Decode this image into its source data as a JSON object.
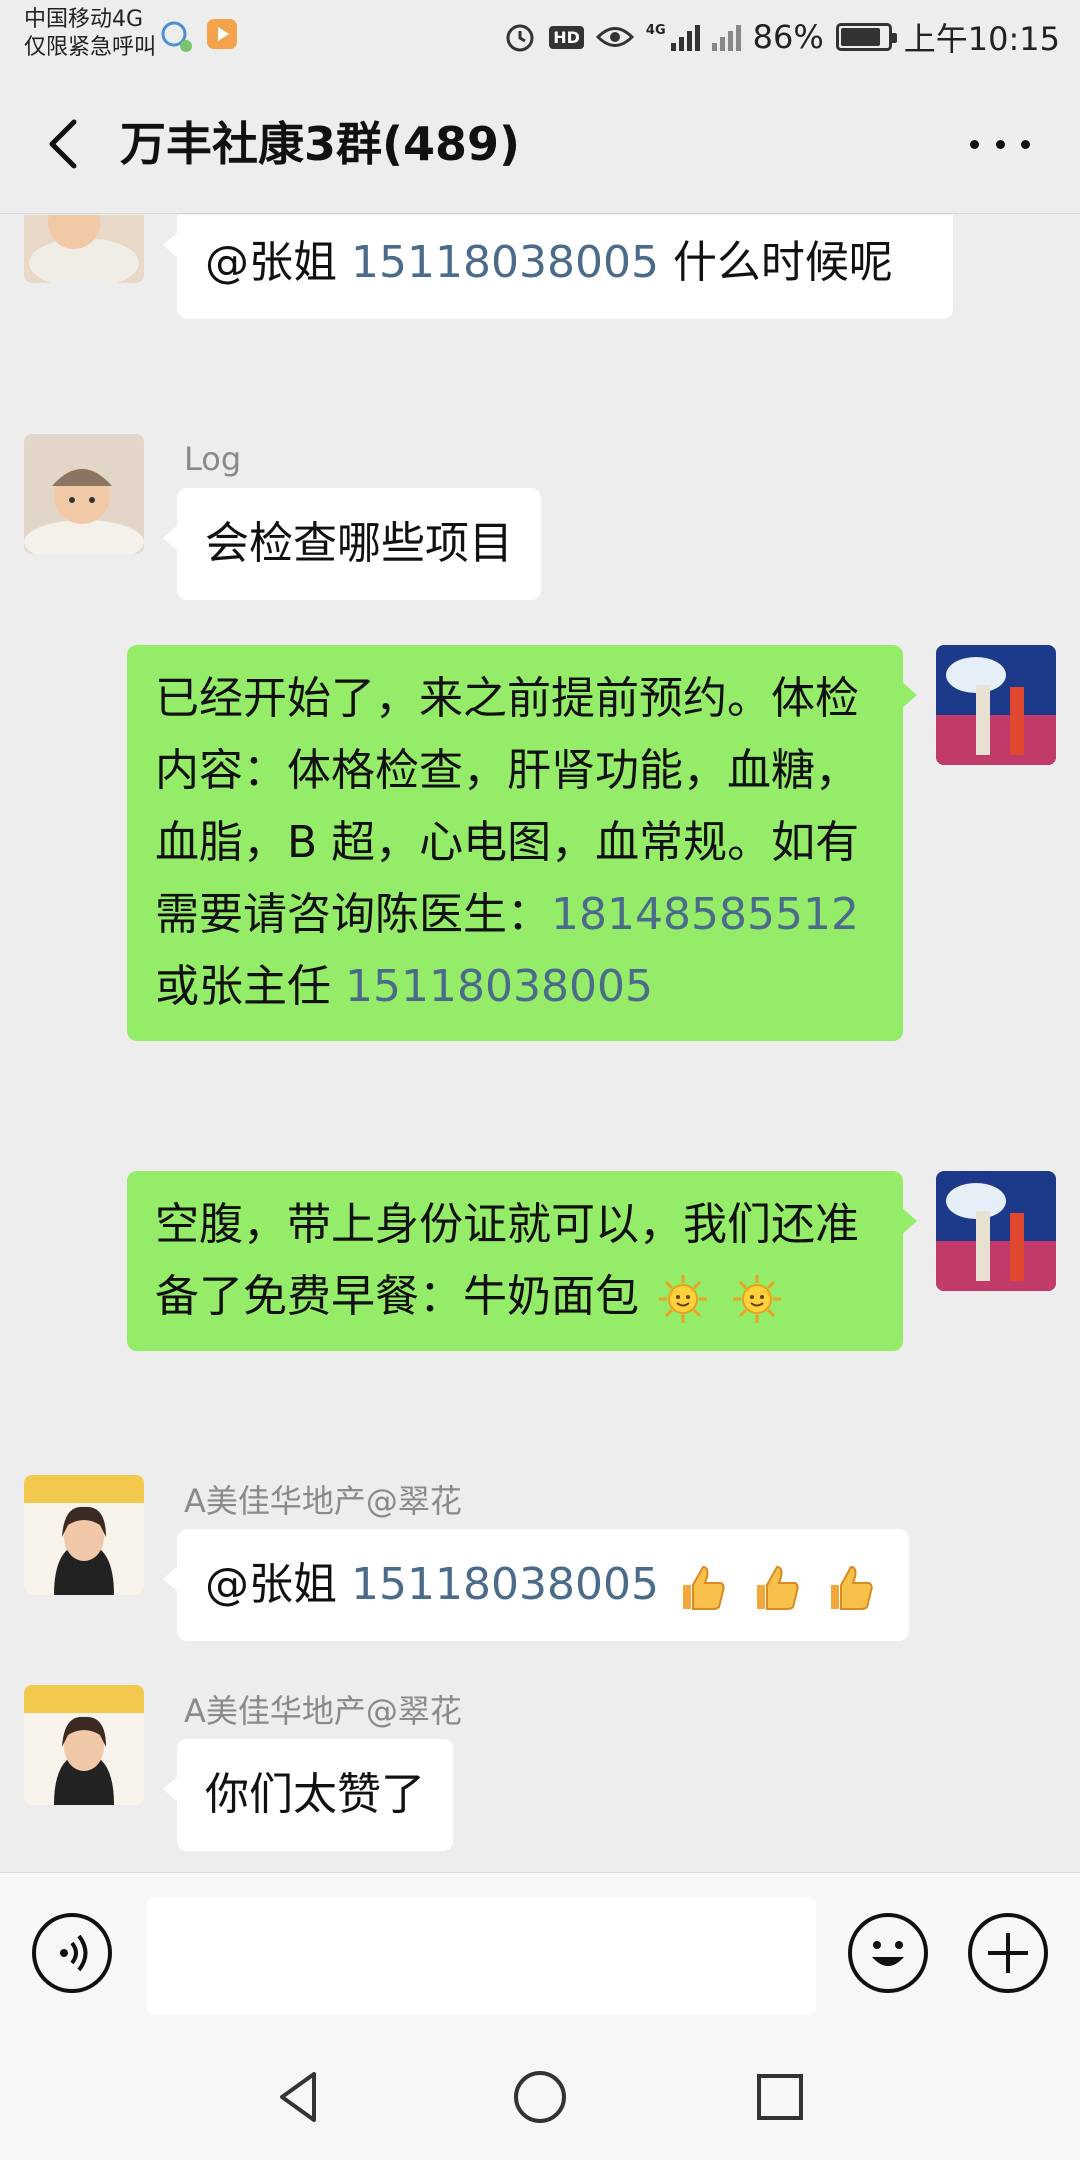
{
  "status_bar": {
    "carrier_line1": "中国移动4G",
    "carrier_line2": "仅限紧急呼叫",
    "hd_badge": "HD",
    "net_label": "4G",
    "battery": "86%",
    "battery_level": 0.86,
    "time": "上午10:15"
  },
  "header": {
    "title": "万丰社康3群(489)"
  },
  "messages": [
    {
      "side": "left",
      "sender": "",
      "text_prefix": "@张姐 ",
      "phone": "15118038005",
      "text_suffix": " 什么时候呢"
    },
    {
      "side": "left",
      "sender": "Log",
      "text": "会检查哪些项目"
    },
    {
      "side": "right",
      "text_main": "已经开始了，来之前提前预约。体检内容：体格检查，肝肾功能，血糖，血脂，B 超，心电图，血常规。如有需要请咨询陈医生：",
      "phone1": "18148585512",
      "text_mid": "或张主任",
      "phone2": "15118038005"
    },
    {
      "side": "right",
      "text": "空腹，带上身份证就可以，我们还准备了免费早餐：牛奶面包",
      "emoji": "sun"
    },
    {
      "side": "left",
      "sender": "A美佳华地产@翠花",
      "text_prefix": "@张姐 ",
      "phone": "15118038005",
      "emoji": "thumbs-up x3"
    },
    {
      "side": "left",
      "sender": "A美佳华地产@翠花",
      "text": "你们太赞了"
    }
  ],
  "input": {
    "placeholder": ""
  },
  "colors": {
    "background": "#ededed",
    "bubble_green": "#95ec69",
    "bubble_white": "#ffffff",
    "link": "#4a6b8a"
  }
}
